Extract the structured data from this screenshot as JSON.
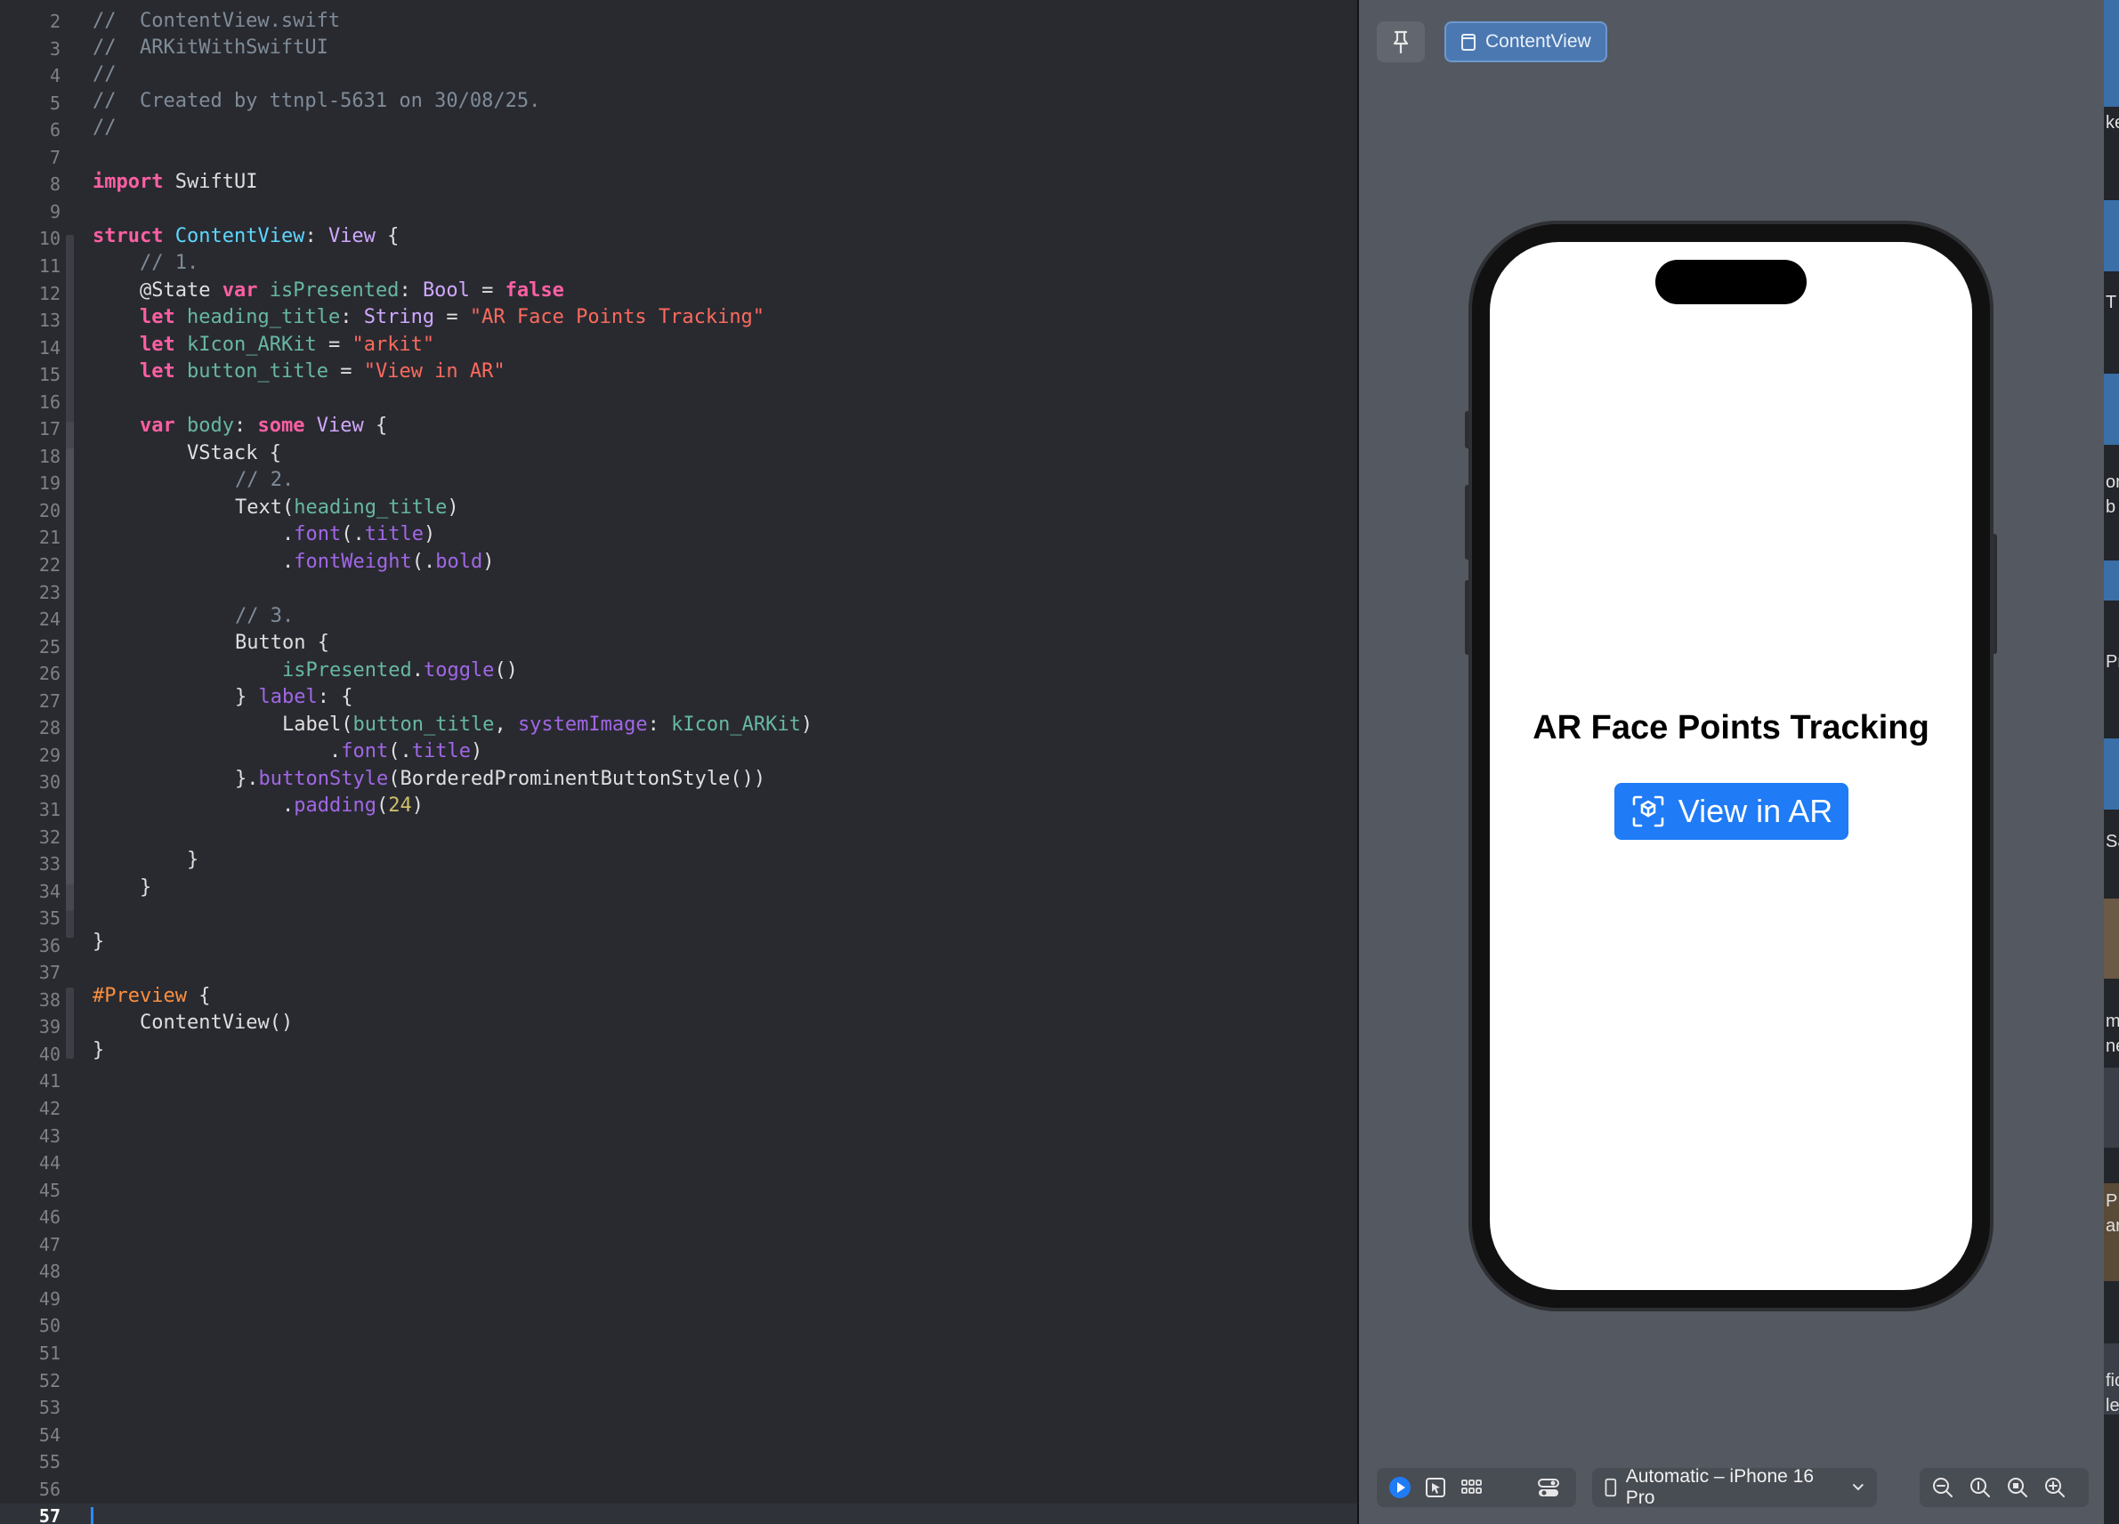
{
  "editor": {
    "line_numbers": [
      "2",
      "3",
      "4",
      "5",
      "6",
      "7",
      "8",
      "9",
      "10",
      "11",
      "12",
      "13",
      "14",
      "15",
      "16",
      "17",
      "18",
      "19",
      "20",
      "21",
      "22",
      "23",
      "24",
      "25",
      "26",
      "27",
      "28",
      "29",
      "30",
      "31",
      "32",
      "33",
      "34",
      "35",
      "36",
      "37",
      "38",
      "39",
      "40",
      "41",
      "42",
      "43",
      "44",
      "45",
      "46",
      "47",
      "48",
      "49",
      "50",
      "51",
      "52",
      "53",
      "54",
      "55",
      "56",
      "57"
    ],
    "current_line": "57",
    "code": {
      "l2": "//  ContentView.swift",
      "l3": "//  ARKitWithSwiftUI",
      "l4": "//",
      "l5": "//  Created by ttnpl-5631 on 30/08/25.",
      "l6": "//",
      "l8_kw": "import",
      "l8_rest": " SwiftUI",
      "l10_kw": "struct",
      "l10_name": "ContentView",
      "l10_colon": ": ",
      "l10_type": "View",
      "l10_brace": " {",
      "l11": "// 1.",
      "l12_attr": "@State",
      "l12_var": "var",
      "l12_name": "isPresented",
      "l12_colon": ": ",
      "l12_type": "Bool",
      "l12_eq": " = ",
      "l12_val": "false",
      "l13_kw": "let",
      "l13_name": "heading_title",
      "l13_colon": ": ",
      "l13_type": "String",
      "l13_eq": " = ",
      "l13_str": "\"AR Face Points Tracking\"",
      "l14_kw": "let",
      "l14_name": "kIcon_ARKit",
      "l14_eq": " = ",
      "l14_str": "\"arkit\"",
      "l15_kw": "let",
      "l15_name": "button_title",
      "l15_eq": " = ",
      "l15_str": "\"View in AR\"",
      "l17_var": "var",
      "l17_name": "body",
      "l17_colon": ": ",
      "l17_some": "some",
      "l17_type": "View",
      "l17_brace": " {",
      "l18": "VStack {",
      "l19": "// 2.",
      "l20_fn": "Text",
      "l20_open": "(",
      "l20_arg": "heading_title",
      "l20_close": ")",
      "l21_dot": ".",
      "l21_fn": "font",
      "l21_open": "(.",
      "l21_arg": "title",
      "l21_close": ")",
      "l22_dot": ".",
      "l22_fn": "fontWeight",
      "l22_open": "(.",
      "l22_arg": "bold",
      "l22_close": ")",
      "l24": "// 3.",
      "l25": "Button {",
      "l26_obj": "isPresented",
      "l26_dot": ".",
      "l26_fn": "toggle",
      "l26_close": "()",
      "l27_close": "} ",
      "l27_label": "label",
      "l27_rest": ": {",
      "l28_fn": "Label",
      "l28_open": "(",
      "l28_arg1": "button_title",
      "l28_comma": ", ",
      "l28_param": "systemImage",
      "l28_colon": ": ",
      "l28_arg2": "kIcon_ARKit",
      "l28_close": ")",
      "l29_dot": ".",
      "l29_fn": "font",
      "l29_open": "(.",
      "l29_arg": "title",
      "l29_close": ")",
      "l30_close": "}.",
      "l30_fn": "buttonStyle",
      "l30_open": "(",
      "l30_type": "BorderedProminentButtonStyle",
      "l30_end": "())",
      "l31_dot": ".",
      "l31_fn": "padding",
      "l31_open": "(",
      "l31_num": "24",
      "l31_close": ")",
      "l33": "}",
      "l34": "}",
      "l36": "}",
      "l38_dir": "#Preview",
      "l38_brace": " {",
      "l39": "ContentView()",
      "l40": "}"
    }
  },
  "canvas": {
    "preview_tab_label": "ContentView",
    "app": {
      "heading_title": "AR Face Points Tracking",
      "button_title": "View in AR"
    },
    "toolbar": {
      "device_label": "Automatic – iPhone 16 Pro"
    }
  },
  "right_strip": {
    "fragments": [
      "ke",
      "T",
      "on",
      "b",
      "Pr",
      "Sa",
      "m",
      "ne",
      "PE",
      "ar",
      "fic",
      "le"
    ]
  },
  "colors": {
    "editor_bg": "#292a30",
    "canvas_bg": "#545961",
    "accent_blue": "#1f7bf6",
    "keyword_pink": "#fc5fa3",
    "string_red": "#fc6a5d",
    "comment_gray": "#7f8c98"
  }
}
